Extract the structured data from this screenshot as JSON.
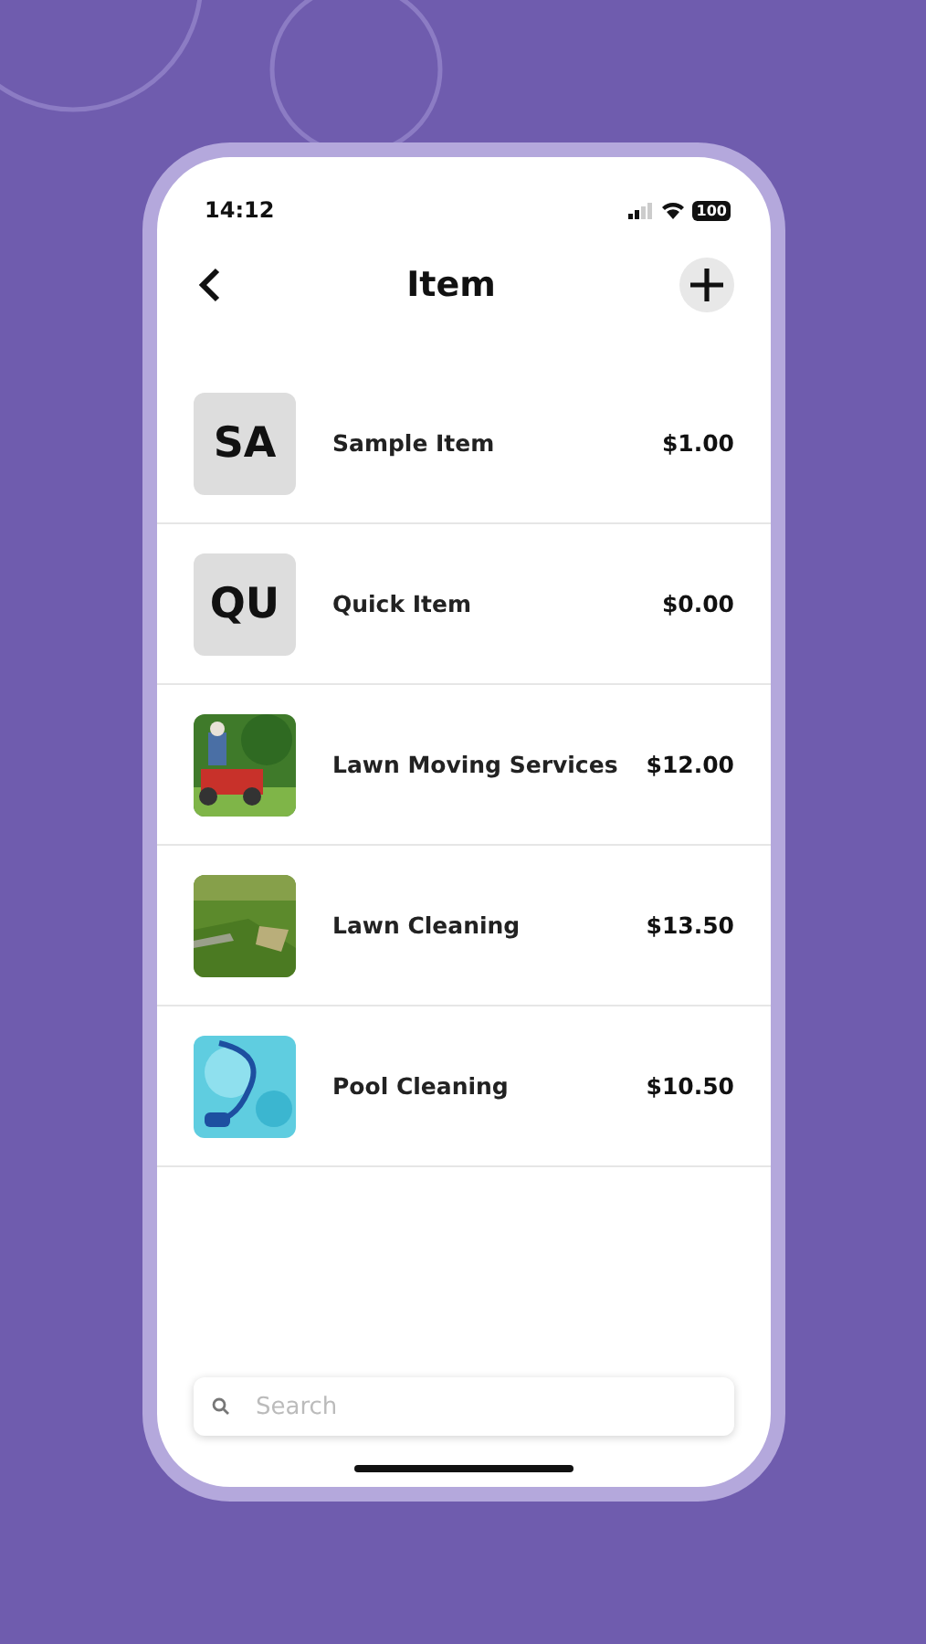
{
  "status_bar": {
    "time": "14:12",
    "battery": "100"
  },
  "header": {
    "title": "Item"
  },
  "items": [
    {
      "kind": "initials",
      "initials": "SA",
      "name": "Sample Item",
      "price": "$1.00"
    },
    {
      "kind": "initials",
      "initials": "QU",
      "name": "Quick Item",
      "price": "$0.00"
    },
    {
      "kind": "picture",
      "name": "Lawn Moving Services",
      "price": "$12.00"
    },
    {
      "kind": "picture",
      "name": "Lawn Cleaning",
      "price": "$13.50"
    },
    {
      "kind": "picture",
      "name": "Pool Cleaning",
      "price": "$10.50"
    }
  ],
  "search": {
    "placeholder": "Search"
  }
}
